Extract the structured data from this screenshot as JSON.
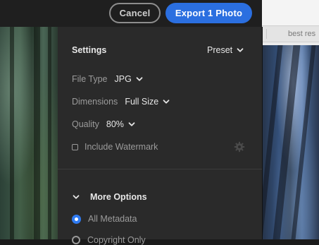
{
  "toolbar": {
    "cancel_label": "Cancel",
    "export_label": "Export 1 Photo"
  },
  "settings": {
    "title": "Settings",
    "preset_label": "Preset",
    "file_type": {
      "label": "File Type",
      "value": "JPG"
    },
    "dimensions": {
      "label": "Dimensions",
      "value": "Full Size"
    },
    "quality": {
      "label": "Quality",
      "value": "80%"
    },
    "watermark": {
      "label": "Include Watermark",
      "checked": false
    }
  },
  "more_options": {
    "title": "More Options",
    "expanded": true,
    "metadata_options": [
      {
        "label": "All Metadata",
        "selected": true
      },
      {
        "label": "Copyright Only",
        "selected": false
      }
    ]
  },
  "background_window": {
    "tab_text": "best res"
  },
  "colors": {
    "accent": "#2b6fe0",
    "radio_selected": "#2f7bf2",
    "panel_bg": "#2a2a2a"
  },
  "icons": {
    "preset": "chevron-down-icon",
    "more_options": "chevron-down-icon",
    "watermark_settings": "gear-icon"
  }
}
